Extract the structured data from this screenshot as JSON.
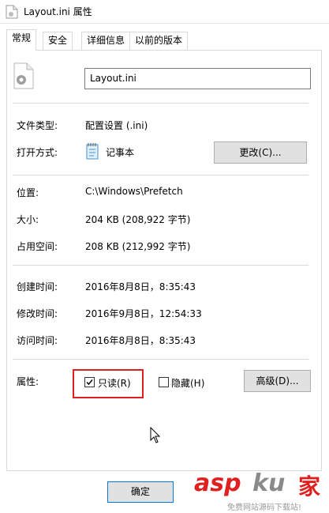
{
  "window": {
    "title": "Layout.ini 属性"
  },
  "tabs": [
    {
      "label": "常规",
      "active": true
    },
    {
      "label": "安全",
      "active": false
    },
    {
      "label": "详细信息",
      "active": false
    },
    {
      "label": "以前的版本",
      "active": false
    }
  ],
  "general": {
    "file_name": "Layout.ini",
    "file_type_label": "文件类型:",
    "file_type_value": "配置设置 (.ini)",
    "open_with_label": "打开方式:",
    "open_with_value": "记事本",
    "change_button": "更改(C)...",
    "location_label": "位置:",
    "location_value": "C:\\Windows\\Prefetch",
    "size_label": "大小:",
    "size_value": "204 KB (208,922 字节)",
    "disk_size_label": "占用空间:",
    "disk_size_value": "208 KB (212,992 字节)",
    "created_label": "创建时间:",
    "created_value": "2016年8月8日，8:35:43",
    "modified_label": "修改时间:",
    "modified_value": "2016年9月8日，12:54:33",
    "accessed_label": "访问时间:",
    "accessed_value": "2016年8月8日，8:35:43",
    "attributes_label": "属性:",
    "readonly_label": "只读(R)",
    "readonly_checked": true,
    "hidden_label": "隐藏(H)",
    "hidden_checked": false,
    "advanced_button": "高级(D)..."
  },
  "footer": {
    "ok_button": "确定"
  },
  "watermark": {
    "text": "asp",
    "text2": "ku",
    "text3": "家",
    "subtext": "免费网站源码下载站!"
  },
  "colors": {
    "highlight": "#e02020",
    "accent": "#0078d7"
  }
}
